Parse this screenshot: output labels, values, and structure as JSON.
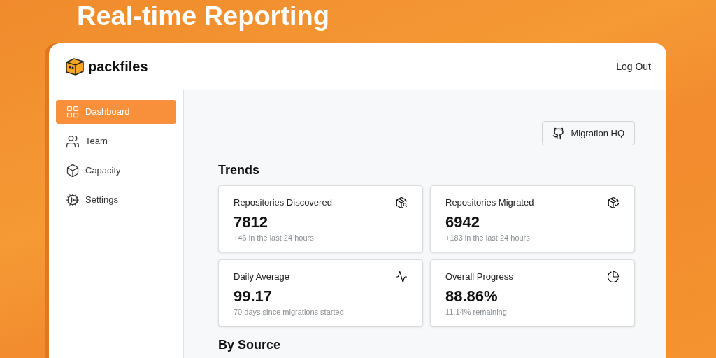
{
  "headline": "Real-time Reporting",
  "app": {
    "brand": "packfiles",
    "logout": "Log Out"
  },
  "sidebar": {
    "items": [
      {
        "label": "Dashboard",
        "selected": true
      },
      {
        "label": "Team",
        "selected": false
      },
      {
        "label": "Capacity",
        "selected": false
      },
      {
        "label": "Settings",
        "selected": false
      }
    ]
  },
  "main": {
    "button": "Migration HQ",
    "section": "Trends",
    "stats": [
      {
        "title": "Repositories Discovered",
        "value": "7812",
        "note": "+46 in the last 24 hours"
      },
      {
        "title": "Repositories Migrated",
        "value": "6942",
        "note": "+183 in the last 24 hours"
      },
      {
        "title": "Daily Average",
        "value": "99.17",
        "note": "70 days since migrations started"
      },
      {
        "title": "Overall Progress",
        "value": "88.86%",
        "note": "11.14% remaining"
      }
    ],
    "section_2": "By Source"
  }
}
